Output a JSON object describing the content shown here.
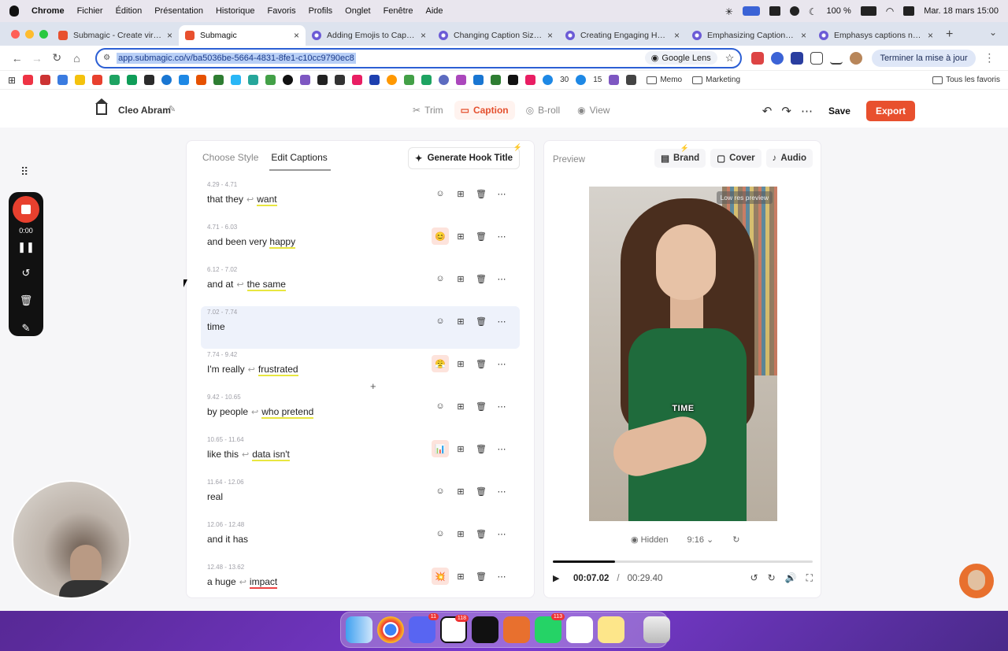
{
  "menubar": {
    "app": "Chrome",
    "items": [
      "Fichier",
      "Édition",
      "Présentation",
      "Historique",
      "Favoris",
      "Profils",
      "Onglet",
      "Fenêtre",
      "Aide"
    ],
    "battery": "100 %",
    "datetime": "Mar. 18 mars  15:00"
  },
  "tabs": [
    {
      "title": "Submagic - Create viral sh",
      "icon": "submagic-icon",
      "active": false
    },
    {
      "title": "Submagic",
      "icon": "submagic-icon",
      "active": true
    },
    {
      "title": "Adding Emojis to Caption",
      "icon": "gear-icon",
      "active": false
    },
    {
      "title": "Changing Caption Sizes i",
      "icon": "gear-icon",
      "active": false
    },
    {
      "title": "Creating Engaging Hook T",
      "icon": "gear-icon",
      "active": false
    },
    {
      "title": "Emphasizing Captions Ma",
      "icon": "gear-icon",
      "active": false
    },
    {
      "title": "Emphasys captions need",
      "icon": "gear-icon",
      "active": false
    }
  ],
  "toolbar": {
    "url": "app.submagic.co/v/ba5036be-5664-4831-8fe1-c10cc9790ec8",
    "lens": "Google Lens",
    "update": "Terminer la mise à jour"
  },
  "bookmarks": {
    "count_a": "30",
    "count_b": "15",
    "memo": "Memo",
    "marketing": "Marketing",
    "all": "Tous les favoris"
  },
  "app": {
    "project": "Cleo Abram",
    "modes": [
      "Trim",
      "Caption",
      "B-roll",
      "View"
    ],
    "active_mode": "Caption",
    "save": "Save",
    "export": "Export",
    "accent": "#e8502e"
  },
  "captions_panel": {
    "tab_style": "Choose Style",
    "tab_edit": "Edit Captions",
    "hook_button": "Generate Hook Title",
    "rows": [
      {
        "time": "4.29 - 4.71",
        "before": "that they",
        "arrow": true,
        "after": "want",
        "emoji": "",
        "selected": false
      },
      {
        "time": "4.71 - 6.03",
        "before": "and been very",
        "arrow": false,
        "after": "happy",
        "emoji": "😊",
        "selected": false
      },
      {
        "time": "6.12 - 7.02",
        "before": "and at",
        "arrow": true,
        "after": "the same",
        "emoji": "",
        "selected": false
      },
      {
        "time": "7.02 - 7.74",
        "before": "time",
        "arrow": false,
        "after": "",
        "emoji": "",
        "selected": true
      },
      {
        "time": "7.74 - 9.42",
        "before": "I'm really",
        "arrow": true,
        "after": "frustrated",
        "emoji": "😤",
        "selected": false
      },
      {
        "time": "9.42 - 10.65",
        "before": "by people",
        "arrow": true,
        "after": "who pretend",
        "emoji": "",
        "selected": false
      },
      {
        "time": "10.65 - 11.64",
        "before": "like this",
        "arrow": true,
        "after": "data isn't",
        "emoji": "📊",
        "selected": false
      },
      {
        "time": "11.64 - 12.06",
        "before": "real",
        "arrow": false,
        "after": "",
        "emoji": "",
        "selected": false
      },
      {
        "time": "12.06 - 12.48",
        "before": "and  it  has",
        "arrow": false,
        "after": "",
        "emoji": "",
        "selected": false
      },
      {
        "time": "12.48 - 13.62",
        "before": "a  huge",
        "arrow": true,
        "after": "impact",
        "emoji": "💥",
        "selected": false
      }
    ]
  },
  "preview": {
    "title": "Preview",
    "tabs": [
      "Brand",
      "Cover",
      "Audio"
    ],
    "low_res": "Low res preview",
    "caption": "TIME",
    "visibility": "Hidden",
    "ratio": "9:16",
    "current": "00:07.02",
    "total": "00:29.40",
    "progress": 0.24
  },
  "recorder": {
    "time": "0:00"
  },
  "dock": {
    "badges": {
      "discord": "11",
      "notion": "118",
      "whatsapp": "113"
    }
  }
}
